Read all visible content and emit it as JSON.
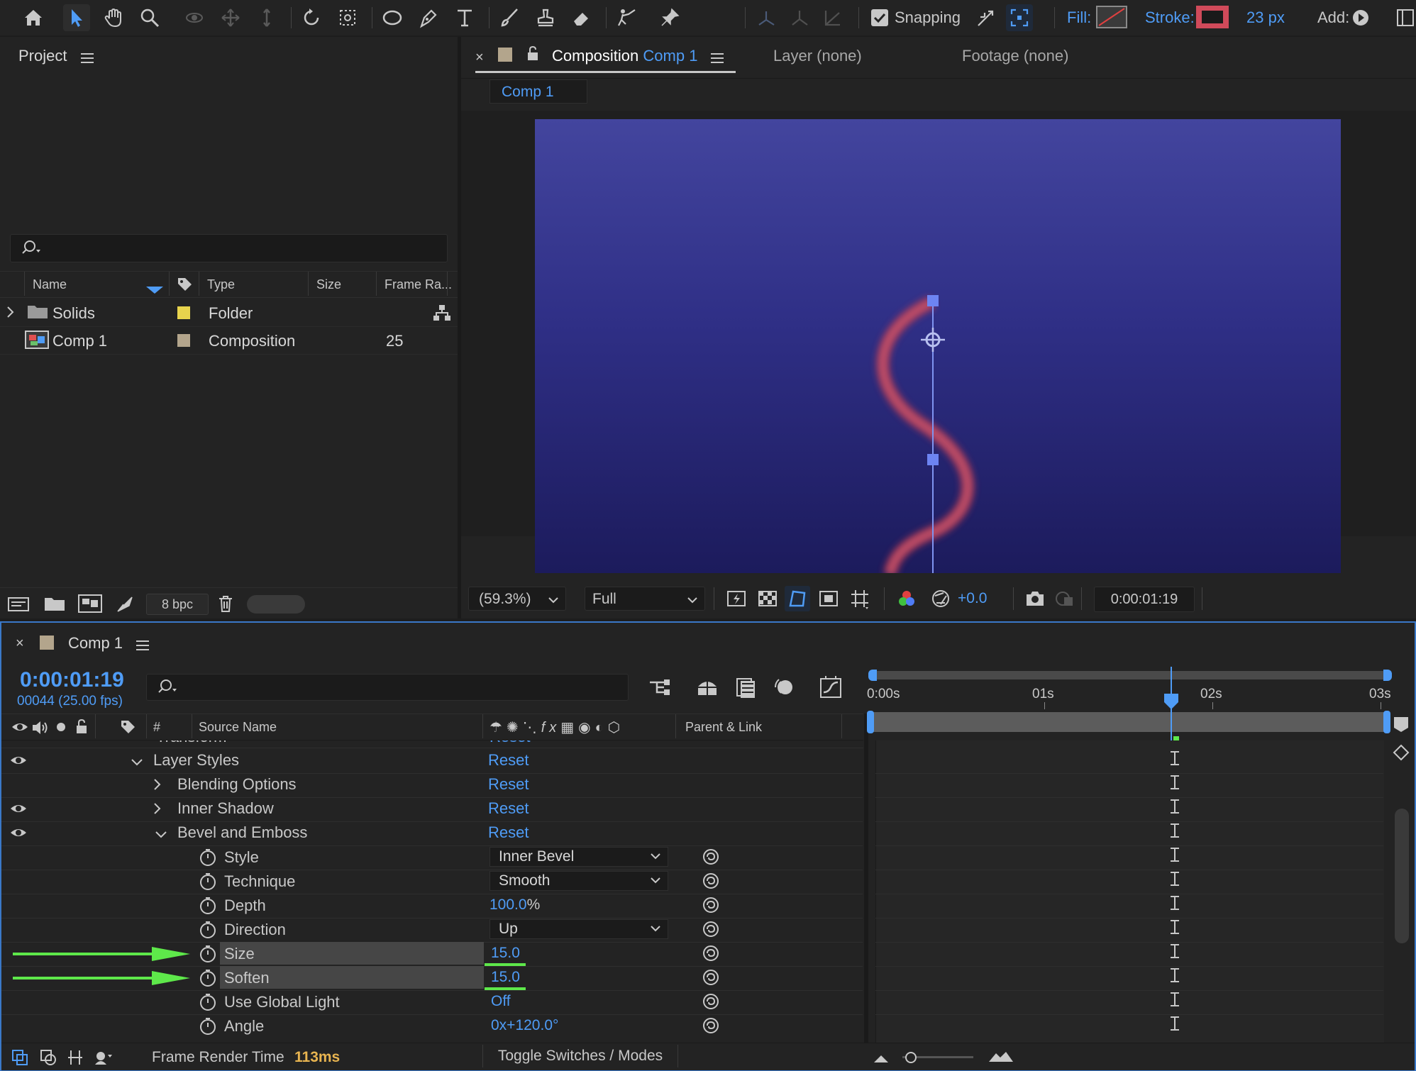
{
  "toolbar": {
    "snapping_label": "Snapping",
    "fill_label": "Fill:",
    "stroke_label": "Stroke:",
    "stroke_width": "23 px",
    "add_label": "Add:",
    "snapping_checked": true,
    "stroke_color": "#d04a5a"
  },
  "project": {
    "title": "Project",
    "search_placeholder": "",
    "columns": [
      "Name",
      "Type",
      "Size",
      "Frame Ra..."
    ],
    "items": [
      {
        "name": "Solids",
        "type": "Folder",
        "size": "",
        "frame_rate": "",
        "label_color": "#e8d44d",
        "icon": "folder-icon"
      },
      {
        "name": "Comp 1",
        "type": "Composition",
        "size": "",
        "frame_rate": "25",
        "label_color": "#b3a58c",
        "icon": "composition-icon"
      }
    ],
    "bpc": "8 bpc"
  },
  "viewer": {
    "tab_prefix": "Composition",
    "tab_comp": "Comp 1",
    "layer_tab": "Layer (none)",
    "footage_tab": "Footage (none)",
    "breadcrumb": "Comp 1",
    "zoom": "(59.3%)",
    "resolution": "Full",
    "exposure": "+0.0",
    "timecode": "0:00:01:19"
  },
  "timeline": {
    "comp_name": "Comp 1",
    "timecode": "0:00:01:19",
    "frame_info": "00044 (25.00 fps)",
    "search_placeholder": "",
    "headers": {
      "number": "#",
      "source_name": "Source Name",
      "parent": "Parent & Link"
    },
    "ruler": [
      "0:00s",
      "01s",
      "02s",
      "03s"
    ],
    "cut_row": {
      "label": "Transform",
      "value": "Reset"
    },
    "rows": [
      {
        "label": "Layer Styles",
        "value": "Reset",
        "kind": "group-open",
        "eye": true
      },
      {
        "label": "Blending Options",
        "value": "Reset",
        "kind": "group-closed",
        "eye": false
      },
      {
        "label": "Inner Shadow",
        "value": "Reset",
        "kind": "group-closed",
        "eye": true
      },
      {
        "label": "Bevel and Emboss",
        "value": "Reset",
        "kind": "group-open",
        "eye": true
      },
      {
        "label": "Style",
        "value": "Inner Bevel",
        "kind": "dropdown"
      },
      {
        "label": "Technique",
        "value": "Smooth",
        "kind": "dropdown"
      },
      {
        "label": "Depth",
        "value": "100.0",
        "unit": "%",
        "kind": "value"
      },
      {
        "label": "Direction",
        "value": "Up",
        "kind": "dropdown"
      },
      {
        "label": "Size",
        "value": "15.0",
        "kind": "value",
        "highlighted": true
      },
      {
        "label": "Soften",
        "value": "15.0",
        "kind": "value",
        "highlighted": true
      },
      {
        "label": "Use Global Light",
        "value": "Off",
        "kind": "value"
      },
      {
        "label": "Angle",
        "value": "0x+120.0°",
        "kind": "value"
      }
    ],
    "render_time_label": "Frame Render Time",
    "render_time_value": "113ms",
    "toggle_label": "Toggle Switches / Modes"
  },
  "colors": {
    "accent": "#4f9cf6",
    "arrow": "#5ee84a",
    "comp_bg_top": "#43459e",
    "comp_bg_bottom": "#1c1b5c"
  }
}
